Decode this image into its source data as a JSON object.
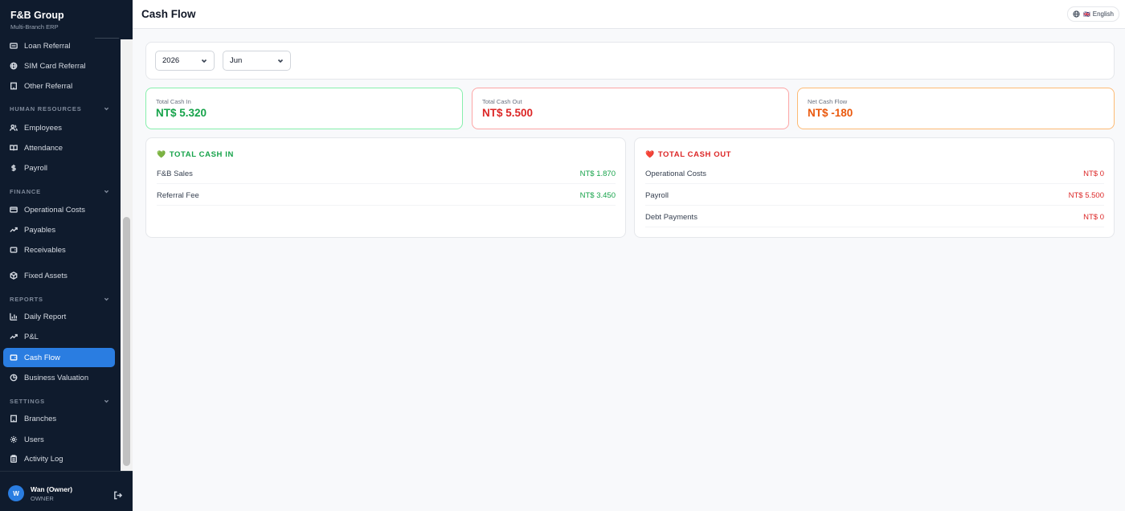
{
  "brand": {
    "title": "F&B Group",
    "subtitle": "Multi-Branch ERP"
  },
  "sidebar": {
    "items_top": [
      {
        "label": "Loan Referral",
        "icon": "id-card-icon"
      },
      {
        "label": "SIM Card Referral",
        "icon": "globe-icon"
      },
      {
        "label": "Other Referral",
        "icon": "building-icon"
      }
    ],
    "sections": {
      "human_resources": "HUMAN RESOURCES",
      "finance": "FINANCE",
      "reports": "REPORTS",
      "settings": "SETTINGS"
    },
    "hr_items": [
      {
        "label": "Employees",
        "icon": "users-icon"
      },
      {
        "label": "Attendance",
        "icon": "book-icon"
      },
      {
        "label": "Payroll",
        "icon": "dollar-icon"
      }
    ],
    "finance_items": [
      {
        "label": "Operational Costs",
        "icon": "card-icon"
      },
      {
        "label": "Payables",
        "icon": "trend-icon"
      },
      {
        "label": "Receivables",
        "icon": "wallet-icon"
      },
      {
        "label": "Fixed Assets",
        "icon": "box-icon"
      }
    ],
    "report_items": [
      {
        "label": "Daily Report",
        "icon": "bar-chart-icon"
      },
      {
        "label": "P&L",
        "icon": "trend-icon"
      },
      {
        "label": "Cash Flow",
        "icon": "wallet-icon",
        "active": true
      },
      {
        "label": "Business Valuation",
        "icon": "pie-icon"
      }
    ],
    "settings_items": [
      {
        "label": "Branches",
        "icon": "building-icon"
      },
      {
        "label": "Users",
        "icon": "gear-icon"
      },
      {
        "label": "Activity Log",
        "icon": "clipboard-icon"
      }
    ]
  },
  "user": {
    "initial": "W",
    "name": "Wan (Owner)",
    "role": "OWNER"
  },
  "header": {
    "title": "Cash Flow",
    "language": "English",
    "flag": "🇬🇧"
  },
  "filters": {
    "year": "2026",
    "month": "Jun"
  },
  "summary": {
    "cash_in": {
      "label": "Total Cash In",
      "value": "NT$ 5.320",
      "color": "#16a34a"
    },
    "cash_out": {
      "label": "Total Cash Out",
      "value": "NT$ 5.500",
      "color": "#dc2626"
    },
    "net": {
      "label": "Net Cash Flow",
      "value": "NT$ -180",
      "color": "#ea580c"
    }
  },
  "cash_in": {
    "title": "TOTAL CASH IN",
    "heart": "💚",
    "rows": [
      {
        "label": "F&B Sales",
        "amount": "NT$ 1.870"
      },
      {
        "label": "Referral Fee",
        "amount": "NT$ 3.450"
      }
    ]
  },
  "cash_out": {
    "title": "TOTAL CASH OUT",
    "heart": "❤️",
    "rows": [
      {
        "label": "Operational Costs",
        "amount": "NT$ 0"
      },
      {
        "label": "Payroll",
        "amount": "NT$ 5.500"
      },
      {
        "label": "Debt Payments",
        "amount": "NT$ 0"
      }
    ]
  }
}
